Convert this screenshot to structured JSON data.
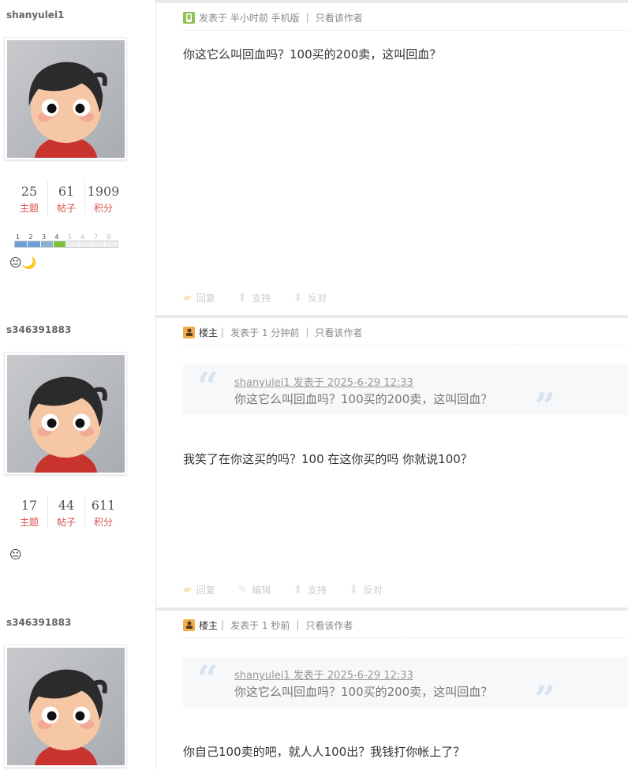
{
  "posts": [
    {
      "author": "shanyulei1",
      "stats": [
        {
          "num": "25",
          "label": "主题"
        },
        {
          "num": "61",
          "label": "帖子"
        },
        {
          "num": "1909",
          "label": "积分"
        }
      ],
      "level": {
        "labels": [
          "1",
          "2",
          "3",
          "4",
          "5",
          "6",
          "7",
          "8"
        ],
        "filled": 4
      },
      "emojis": "😐🌙",
      "meta": {
        "posted": "发表于 半小时前 手机版",
        "only": "只看该作者"
      },
      "text": "你这它么叫回血吗？100买的200卖，这叫回血？",
      "actions": [
        "回复",
        "支持",
        "反对"
      ]
    },
    {
      "author": "s346391883",
      "stats": [
        {
          "num": "17",
          "label": "主题"
        },
        {
          "num": "44",
          "label": "帖子"
        },
        {
          "num": "611",
          "label": "积分"
        }
      ],
      "emojis": "😐",
      "meta": {
        "poster": "楼主",
        "posted": "发表于 1 分钟前",
        "only": "只看该作者"
      },
      "quote": {
        "author": "shanyulei1 发表于 2025-6-29 12:33",
        "text": "你这它么叫回血吗？100买的200卖，这叫回血？"
      },
      "text": "我笑了在你这买的吗？100 在这你买的吗 你就说100？",
      "actions": [
        "回复",
        "编辑",
        "支持",
        "反对"
      ]
    },
    {
      "author": "s346391883",
      "meta": {
        "poster": "楼主",
        "posted": "发表于 1 秒前",
        "only": "只看该作者"
      },
      "quote": {
        "author": "shanyulei1 发表于 2025-6-29 12:33",
        "text": "你这它么叫回血吗？100买的200卖，这叫回血？"
      },
      "text": "你自己100卖的吧，就人人100出？我钱打你帐上了？"
    }
  ],
  "colors": {
    "accent_red": "#d9534f",
    "level_blue": "#6a9fd8",
    "level_green": "#7bbf3a"
  }
}
